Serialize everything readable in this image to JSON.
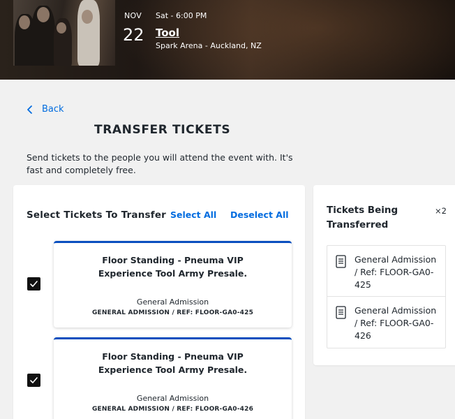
{
  "event": {
    "month": "NOV",
    "day": "22",
    "time": "Sat - 6:00 PM",
    "name": "Tool",
    "venue": "Spark Arena - Auckland, NZ"
  },
  "nav": {
    "back_label": "Back"
  },
  "page": {
    "title": "TRANSFER TICKETS",
    "intro": "Send tickets to the people you will attend the event with. It's fast and completely free."
  },
  "select_panel": {
    "heading": "Select Tickets To Transfer",
    "select_all": "Select All",
    "deselect_all": "Deselect All",
    "tickets": [
      {
        "title_line1": "Floor Standing - Pneuma VIP",
        "title_line2": "Experience Tool Army Presale.",
        "type": "General Admission",
        "ref": "GENERAL ADMISSION / REF: FLOOR-GA0-425",
        "checked": true
      },
      {
        "title_line1": "Floor Standing - Pneuma VIP",
        "title_line2": "Experience Tool Army Presale.",
        "type": "General Admission",
        "ref": "GENERAL ADMISSION / REF: FLOOR-GA0-426",
        "checked": true
      }
    ]
  },
  "transfer_panel": {
    "heading": "Tickets Being Transferred",
    "count": "×2",
    "items": [
      {
        "label": "General Admission / Ref: FLOOR-GA0-425"
      },
      {
        "label": "General Admission / Ref: FLOOR-GA0-426"
      }
    ]
  },
  "colors": {
    "accent": "#026cdf",
    "ticket_border": "#0a4fbf",
    "checkbox": "#111111",
    "page_bg": "#f1f1f1"
  },
  "icons": [
    "chevron-left-icon",
    "checkmark-icon",
    "ticket-document-icon"
  ]
}
